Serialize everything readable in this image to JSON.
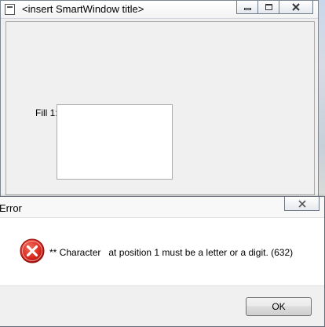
{
  "main_window": {
    "title": "<insert SmartWindow title>",
    "field_label": "Fill 1:",
    "field_value": ""
  },
  "dialog": {
    "title": "Error",
    "message": "** Character   at position 1 must be a letter or a digit. (632)",
    "ok_label": "OK",
    "icon": "error-icon"
  },
  "colors": {
    "error_red": "#d9261c",
    "window_bg": "#f0f0f0"
  }
}
